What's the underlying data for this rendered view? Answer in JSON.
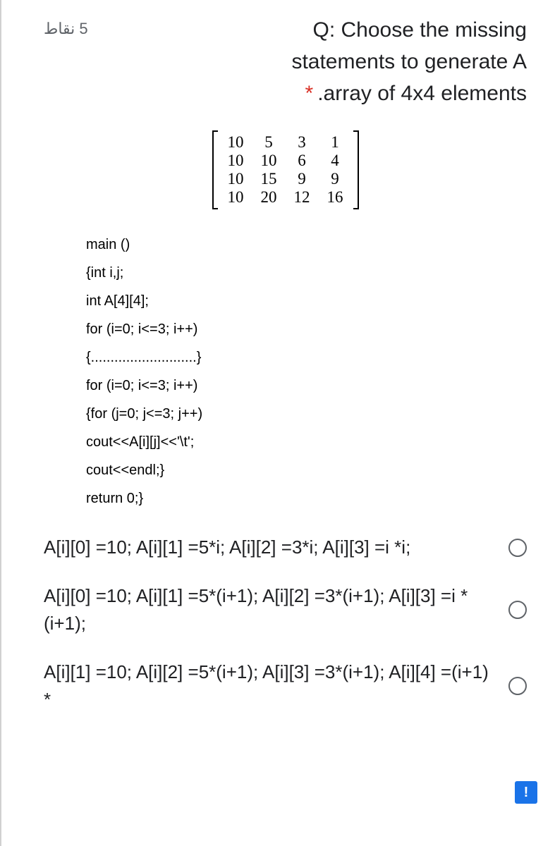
{
  "points": "5 نقاط",
  "question": {
    "title_line1": "Q: Choose the missing",
    "title_line2": "statements to generate A",
    "title_line3": ".array of 4x4 elements"
  },
  "matrix": {
    "rows": [
      [
        "10",
        "5",
        "3",
        "1"
      ],
      [
        "10",
        "10",
        "6",
        "4"
      ],
      [
        "10",
        "15",
        "9",
        "9"
      ],
      [
        "10",
        "20",
        "12",
        "16"
      ]
    ]
  },
  "code": {
    "l1": "main ()",
    "l2": "{int i,j;",
    "l3": "int A[4][4];",
    "l4": "for (i=0; i<=3; i++)",
    "l5": "{...........................}",
    "l6": "for (i=0; i<=3; i++)",
    "l7": "{for (j=0; j<=3; j++)",
    "l8": "cout<<A[i][j]<<'\\t';",
    "l9": "cout<<endl;}",
    "l10": "return 0;}"
  },
  "options": {
    "opt1": "A[i][0] =10; A[i][1] =5*i; A[i][2] =3*i; A[i][3] =i *i;",
    "opt2": "A[i][0] =10; A[i][1] =5*(i+1); A[i][2] =3*(i+1); A[i][3] =i *(i+1);",
    "opt3": "A[i][1] =10; A[i][2] =5*(i+1); A[i][3] =3*(i+1); A[i][4] =(i+1) *"
  },
  "feedback_icon": "!"
}
